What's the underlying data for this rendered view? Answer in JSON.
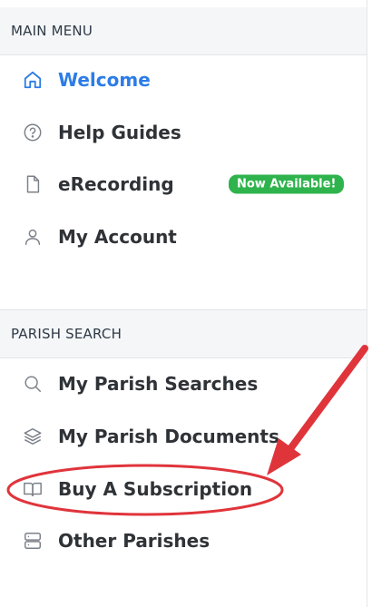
{
  "main_menu": {
    "header": "MAIN MENU",
    "items": [
      {
        "label": "Welcome",
        "icon": "home-icon",
        "active": true
      },
      {
        "label": "Help Guides",
        "icon": "help-circle-icon"
      },
      {
        "label": "eRecording",
        "icon": "file-icon",
        "badge": "Now Available!"
      },
      {
        "label": "My Account",
        "icon": "user-icon"
      }
    ]
  },
  "parish_search": {
    "header": "PARISH SEARCH",
    "items": [
      {
        "label": "My Parish Searches",
        "icon": "search-icon"
      },
      {
        "label": "My Parish Documents",
        "icon": "layers-icon"
      },
      {
        "label": "Buy A Subscription",
        "icon": "book-open-icon",
        "highlighted": true
      },
      {
        "label": "Other Parishes",
        "icon": "server-icon"
      }
    ]
  },
  "colors": {
    "accent": "#2d7ce6",
    "badge_green": "#2fb34d",
    "annotation_red": "#e0343b"
  }
}
